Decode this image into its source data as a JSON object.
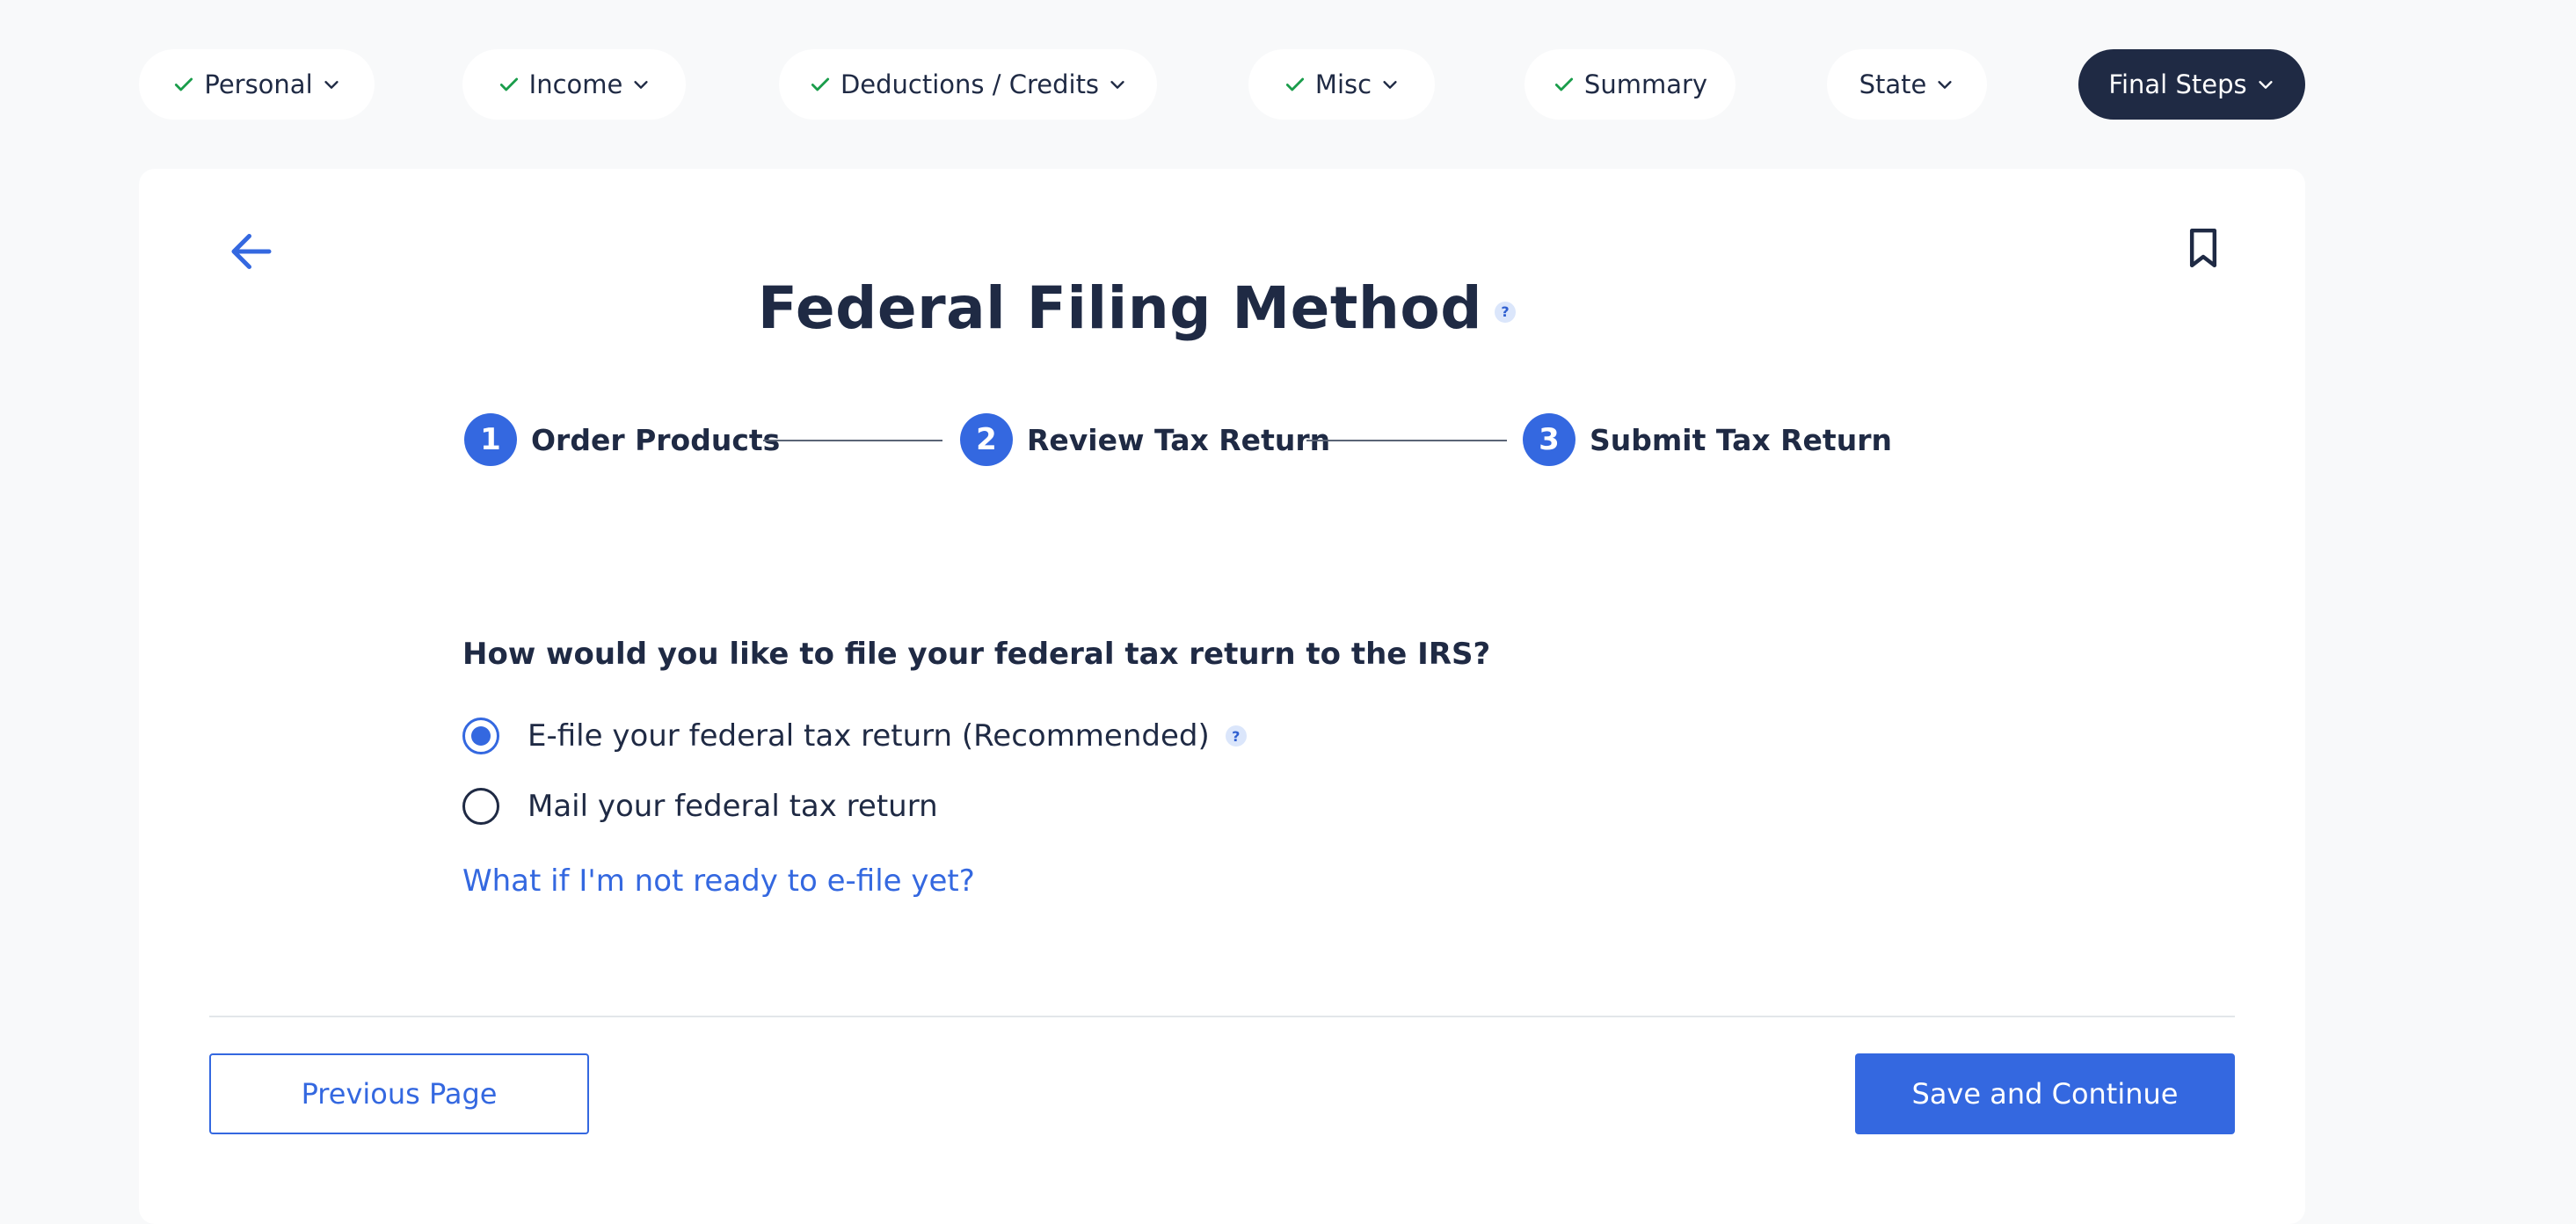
{
  "nav": {
    "items": [
      {
        "label": "Personal",
        "completed": true,
        "active": false
      },
      {
        "label": "Income",
        "completed": true,
        "active": false
      },
      {
        "label": "Deductions / Credits",
        "completed": true,
        "active": false
      },
      {
        "label": "Misc",
        "completed": true,
        "active": false
      },
      {
        "label": "Summary",
        "completed": true,
        "active": false
      },
      {
        "label": "State",
        "completed": false,
        "active": false
      },
      {
        "label": "Final Steps",
        "completed": false,
        "active": true
      }
    ]
  },
  "page": {
    "title": "Federal Filing Method",
    "help_symbol": "?"
  },
  "stepper": {
    "steps": [
      {
        "number": "1",
        "label": "Order Products"
      },
      {
        "number": "2",
        "label": "Review Tax Return"
      },
      {
        "number": "3",
        "label": "Submit Tax Return"
      }
    ]
  },
  "form": {
    "question": "How would you like to file your federal tax return to the IRS?",
    "options": [
      {
        "label": "E-file your federal tax return (Recommended)",
        "selected": true
      },
      {
        "label": "Mail your federal tax return",
        "selected": false
      }
    ],
    "help_link": "What if I'm not ready to e-file yet?"
  },
  "buttons": {
    "previous": "Previous Page",
    "save": "Save and Continue"
  },
  "colors": {
    "accent": "#3468e0",
    "dark": "#1f2a44",
    "success": "#1a9d4b",
    "background": "#f8f9fa"
  }
}
